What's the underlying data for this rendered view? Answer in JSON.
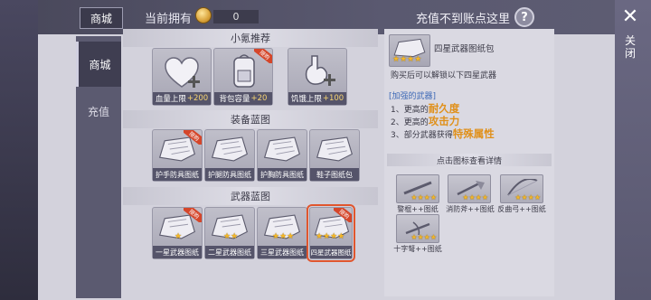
{
  "header": {
    "shop_tab": "商城",
    "balance_label": "当前拥有",
    "coin_value": "0",
    "recharge_question": "充值不到账点这里",
    "help_icon": "?"
  },
  "sidebar": {
    "tabs": [
      {
        "label": "商城"
      },
      {
        "label": "充值"
      }
    ]
  },
  "close": {
    "icon": "✕",
    "label": "关闭"
  },
  "sections": {
    "recommend": {
      "title": "小氪推荐",
      "items": [
        {
          "name": "血量上限",
          "value": "+200",
          "icon": "heart-plus-icon"
        },
        {
          "name": "背包容量",
          "value": "+20",
          "icon": "backpack-icon",
          "badge": "限购"
        },
        {
          "name": "饥饿上限",
          "value": "+100",
          "icon": "stomach-plus-icon"
        }
      ]
    },
    "equip": {
      "title": "装备蓝图",
      "items": [
        {
          "name": "护手防具图纸",
          "badge": "限购"
        },
        {
          "name": "护腿防具图纸"
        },
        {
          "name": "护胸防具图纸"
        },
        {
          "name": "鞋子图纸包"
        }
      ]
    },
    "weapon": {
      "title": "武器蓝图",
      "items": [
        {
          "name": "一星武器图纸",
          "badge": "限购",
          "stars": 1
        },
        {
          "name": "二星武器图纸",
          "stars": 2
        },
        {
          "name": "三星武器图纸",
          "stars": 3
        },
        {
          "name": "四星武器图纸",
          "badge": "限购",
          "stars": 4,
          "selected": true
        }
      ]
    }
  },
  "detail": {
    "title": "四星武器图纸包",
    "desc": "购买后可以解锁以下四星武器",
    "enhanced_head": "[加强的武器]",
    "lines": [
      {
        "prefix": "1、更高的",
        "highlight": "耐久度"
      },
      {
        "prefix": "2、更高的",
        "highlight": "攻击力"
      },
      {
        "prefix": "3、部分武器获得",
        "highlight": "特殊属性"
      }
    ],
    "hint": "点击图标查看详情",
    "weapons": [
      {
        "name": "警棍++图纸"
      },
      {
        "name": "消防斧++图纸"
      },
      {
        "name": "反曲弓++图纸"
      },
      {
        "name": "十字弩++图纸"
      }
    ]
  },
  "colors": {
    "accent": "#e0901a",
    "star": "#f3b628",
    "badge": "#d5462a",
    "info": "#3c68b6"
  }
}
